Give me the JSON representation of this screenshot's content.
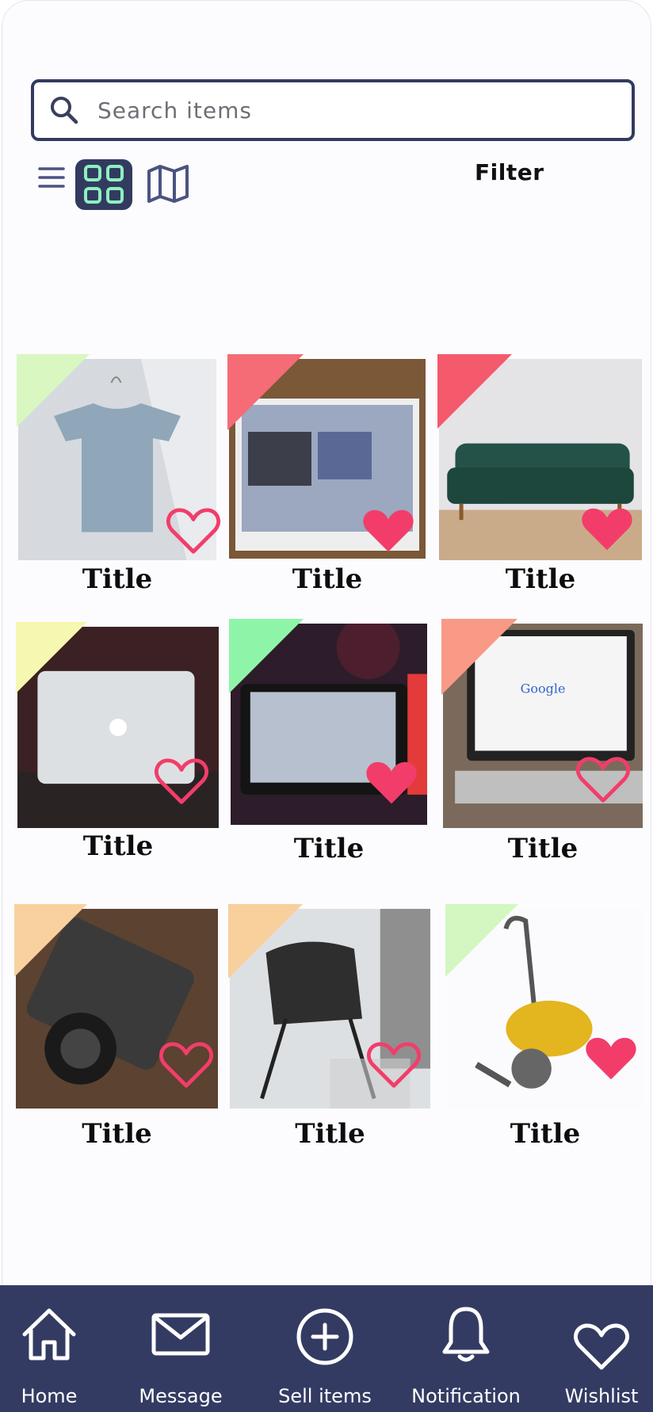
{
  "search": {
    "placeholder": "Search items"
  },
  "toolbar": {
    "view_list_icon": "menu-icon",
    "view_grid_icon": "grid-icon",
    "view_map_icon": "map-icon",
    "filter_label": "Filter"
  },
  "items": [
    {
      "title": "Title",
      "image": "t-shirt",
      "tag_color": "#d9f7c0",
      "favorited": false
    },
    {
      "title": "Title",
      "image": "laptop-screen",
      "tag_color": "#f56b76",
      "favorited": true
    },
    {
      "title": "Title",
      "image": "green-sofa",
      "tag_color": "#f45a6c",
      "favorited": true
    },
    {
      "title": "Title",
      "image": "macbook",
      "tag_color": "#f6f7b0",
      "favorited": false
    },
    {
      "title": "Title",
      "image": "game-console",
      "tag_color": "#8ef5a8",
      "favorited": true
    },
    {
      "title": "Title",
      "image": "google-laptop",
      "tag_color": "#f89a86",
      "favorited": false
    },
    {
      "title": "Title",
      "image": "camera",
      "tag_color": "#f9d19e",
      "favorited": false
    },
    {
      "title": "Title",
      "image": "chair",
      "tag_color": "#f9cf9c",
      "favorited": false
    },
    {
      "title": "Title",
      "image": "vacuum",
      "tag_color": "#d3f7c0",
      "favorited": true
    }
  ],
  "nav": [
    {
      "label": "Home",
      "icon": "home-icon"
    },
    {
      "label": "Message",
      "icon": "mail-icon"
    },
    {
      "label": "Sell items",
      "icon": "plus-circle-icon"
    },
    {
      "label": "Notification",
      "icon": "bell-icon"
    },
    {
      "label": "Wishlist",
      "icon": "heart-icon"
    }
  ],
  "colors": {
    "accent": "#323b5f",
    "heart": "#f23d6a",
    "grid_icon": "#8ef0c0"
  }
}
